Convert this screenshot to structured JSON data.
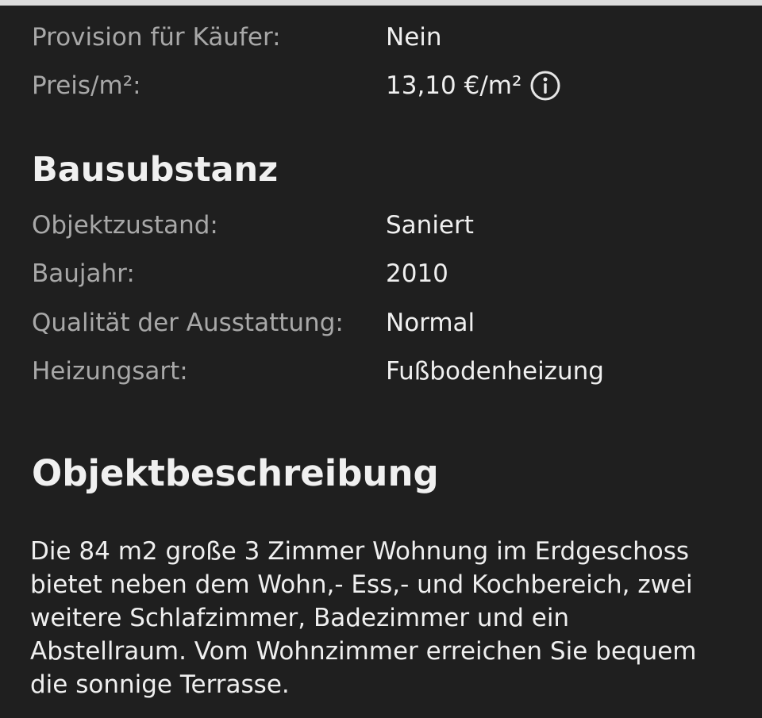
{
  "pricing": {
    "rows": [
      {
        "label": "Provision für Käufer:",
        "value": "Nein"
      },
      {
        "label": "Preis/m²:",
        "value": "13,10 €/m²"
      }
    ]
  },
  "bausubstanz": {
    "title": "Bausubstanz",
    "rows": [
      {
        "label": "Objektzustand:",
        "value": "Saniert"
      },
      {
        "label": "Baujahr:",
        "value": "2010"
      },
      {
        "label": "Qualität der Ausstattung:",
        "value": "Normal"
      },
      {
        "label": "Heizungsart:",
        "value": "Fußbodenheizung"
      }
    ]
  },
  "objektbeschreibung": {
    "title": "Objektbeschreibung",
    "text": "Die 84 m2 große 3 Zimmer Wohnung im Erdgeschoss bietet neben dem Wohn,- Ess,- und Kochbereich, zwei weitere Schlafzimmer, Badezimmer und ein Abstellraum. Vom Wohnzimmer erreichen Sie bequem die sonnige Terrasse."
  },
  "icons": {
    "info": "info-circle-icon"
  },
  "colors": {
    "background": "#1f1f1f",
    "label": "#a8a8a8",
    "value": "#efefef",
    "rule": "#dcdcdc"
  }
}
